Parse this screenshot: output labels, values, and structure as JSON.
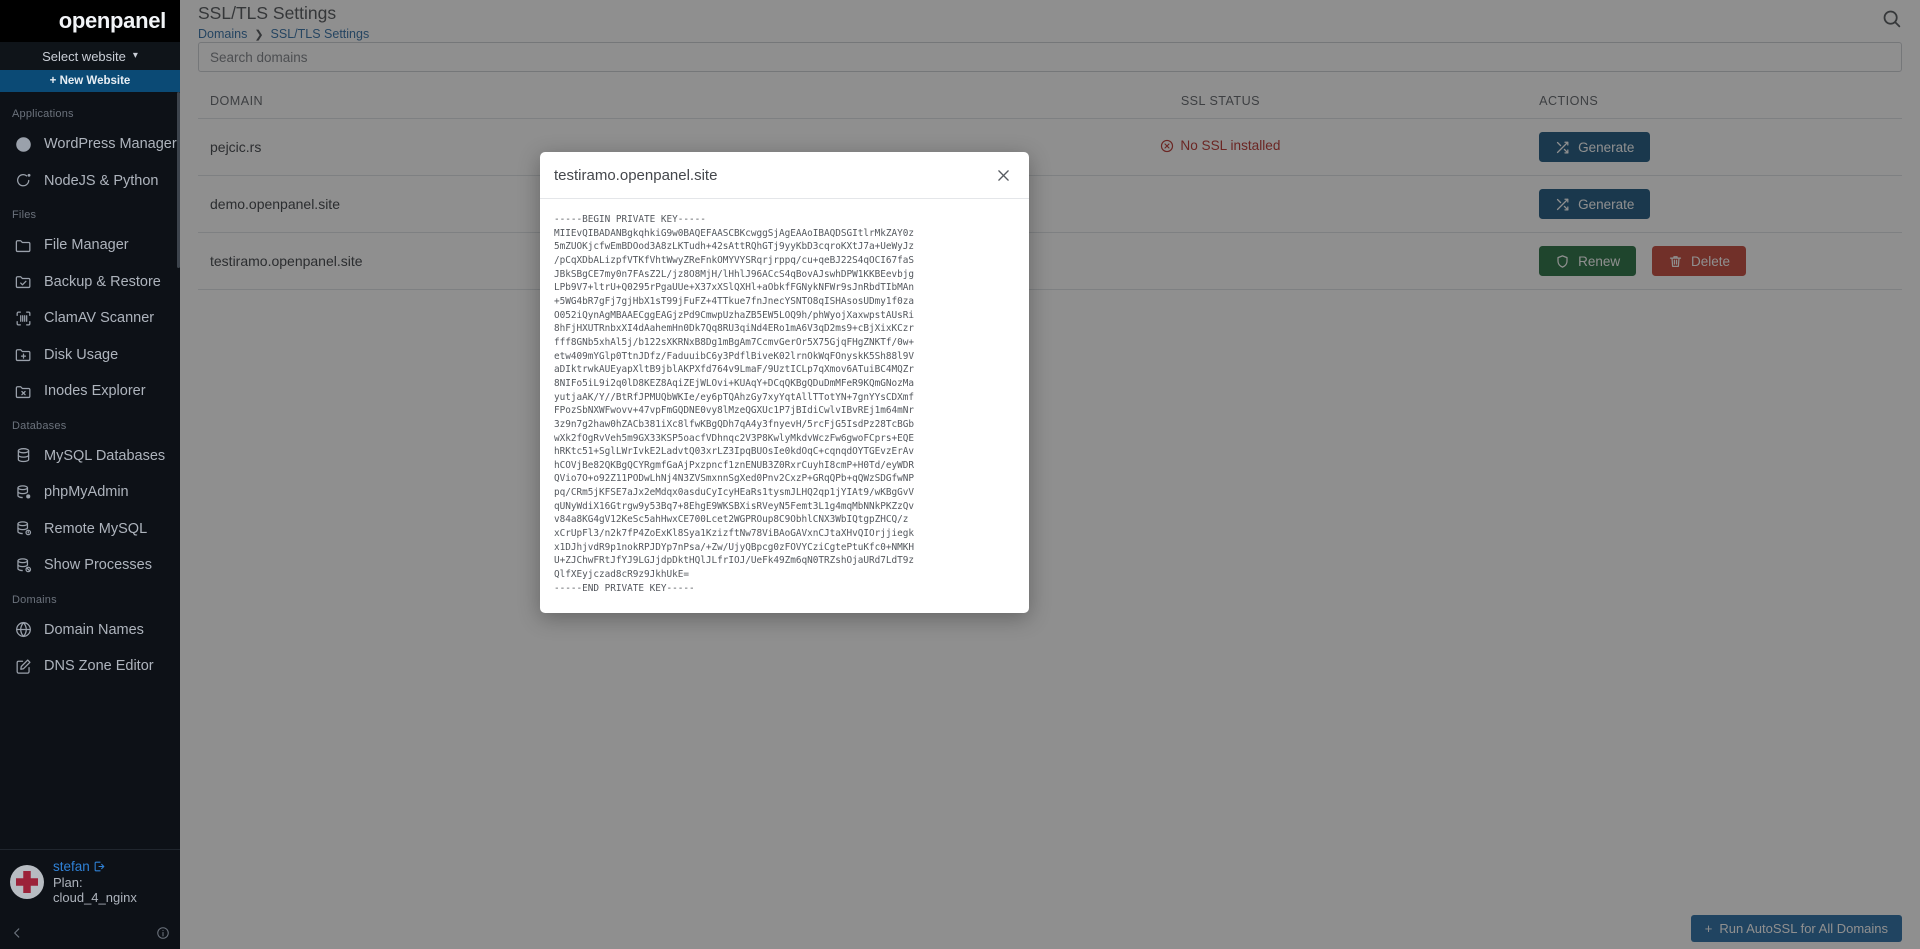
{
  "sidebar": {
    "brand": "openpanel",
    "select_website": "Select website",
    "new_website": "+ New Website",
    "new_website_label": "New Website",
    "groups": [
      {
        "title": "Applications",
        "items": [
          {
            "label": "WordPress Manager",
            "icon": "wordpress-icon"
          },
          {
            "label": "NodeJS & Python",
            "icon": "nodejs-icon"
          }
        ]
      },
      {
        "title": "Files",
        "items": [
          {
            "label": "File Manager",
            "icon": "folder-icon"
          },
          {
            "label": "Backup & Restore",
            "icon": "folder-check-icon"
          },
          {
            "label": "ClamAV Scanner",
            "icon": "scan-icon"
          },
          {
            "label": "Disk Usage",
            "icon": "folder-plus-icon"
          },
          {
            "label": "Inodes Explorer",
            "icon": "folder-x-icon"
          }
        ]
      },
      {
        "title": "Databases",
        "items": [
          {
            "label": "MySQL Databases",
            "icon": "database-icon"
          },
          {
            "label": "phpMyAdmin",
            "icon": "database-gear-icon"
          },
          {
            "label": "Remote MySQL",
            "icon": "database-info-icon"
          },
          {
            "label": "Show Processes",
            "icon": "database-block-icon"
          }
        ]
      },
      {
        "title": "Domains",
        "items": [
          {
            "label": "Domain Names",
            "icon": "globe-icon"
          },
          {
            "label": "DNS Zone Editor",
            "icon": "edit-square-icon"
          }
        ]
      }
    ],
    "user": {
      "name": "stefan",
      "plan": "Plan: cloud_4_nginx"
    }
  },
  "header": {
    "title": "SSL/TLS Settings",
    "breadcrumb": [
      {
        "label": "Domains"
      },
      {
        "label": "SSL/TLS Settings"
      }
    ],
    "breadcrumb_separator": "❯",
    "search_icon": "search-icon"
  },
  "search": {
    "placeholder": "Search domains",
    "value": ""
  },
  "table": {
    "columns": [
      "DOMAIN",
      "SSL STATUS",
      "ACTIONS"
    ],
    "rows": [
      {
        "domain": "pejcic.rs",
        "status": "No SSL installed",
        "status_type": "none",
        "actions": [
          {
            "label": "Generate",
            "type": "generate",
            "icon": "shuffle-icon"
          }
        ]
      },
      {
        "domain": "demo.openpanel.site",
        "status": "",
        "status_type": "hidden",
        "actions": [
          {
            "label": "Generate",
            "type": "generate",
            "icon": "shuffle-icon"
          }
        ]
      },
      {
        "domain": "testiramo.openpanel.site",
        "status": "",
        "status_type": "hidden",
        "actions": [
          {
            "label": "Renew",
            "type": "renew",
            "icon": "shield-icon"
          },
          {
            "label": "Delete",
            "type": "delete",
            "icon": "trash-icon"
          }
        ]
      }
    ]
  },
  "footer": {
    "autossl_label": "Run AutoSSL for All Domains",
    "autossl_icon": "plus-icon"
  },
  "modal": {
    "title": "testiramo.openpanel.site",
    "close_icon": "close-icon",
    "private_key": "-----BEGIN PRIVATE KEY-----\nMIIEvQIBADANBgkqhkiG9w0BAQEFAASCBKcwggSjAgEAAoIBAQDSGItlrMkZAY0z\n5mZUOKjcfwEmBDOod3A8zLKTudh+42sAttRQhGTj9yyKbD3cqroKXtJ7a+UeWyJz\n/pCqXDbALizpfVTKfVhtWwyZReFnkOMYVYSRqrjrppq/cu+qeBJ22S4qOCI67faS\nJBkSBgCE7my0n7FAsZ2L/jz8O8MjH/lHhlJ96ACcS4qBovAJswhDPW1KKBEevbjg\nLPb9V7+ltrU+Q0295rPgaUUe+X37xXSlQXHl+aObkfFGNykNFWr9sJnRbdTIbMAn\n+5WG4bR7gFj7gjHbX1sT99jFuFZ+4TTkue7fnJnecYSNTO8qISHAsosUDmy1f0za\nO052iQynAgMBAAECggEAGjzPd9CmwpUzhaZB5EW5LOQ9h/phWyojXaxwpstAUsRi\n8hFjHXUTRnbxXI4dAahemHn0Dk7Qq8RU3qiNd4ERo1mA6V3qD2ms9+cBjXixKCzr\nfff8GNb5xhAl5j/b122sXKRNxB8Dg1mBgAm7CcmvGerOr5X75GjqFHgZNKTf/0w+\netw409mYGlp0TtnJDfz/FaduuibC6y3PdflBiveK02lrnOkWqFOnyskK5Sh88l9V\naDIktrwkAUEyapXltB9jblAKPXfd764v9LmaF/9UztICLp7qXmov6ATuiBC4MQZr\n8NIFo5iL9i2q0lD8KEZ8AqiZEjWLOvi+KUAqY+DCqQKBgQDuDmMFeR9KQmGNozMa\nyutjaAK/Y//BtRfJPMUQbWKIe/ey6pTQAhzGy7xyYqtAllTTotYN+7gnYYsCDXmf\nFPozSbNXWFwovv+47vpFmGQDNE0vy8lMzeQGXUc1P7jBIdiCwlvIBvREj1m64mNr\n3z9n7g2haw0hZACb381iXc8lfwKBgQDh7qA4y3fnyevH/5rcFjG5IsdPz28TcBGb\nwXk2fOgRvVeh5m9GX33KSP5oacfVDhnqc2V3P8KwlyMkdvWczFw6gwoFCprs+EQE\nhRKtc51+SglLWrIvkE2LadvtQ03xrLZ3IpqBUOsIe0kdOqC+cqnqdOYTGEvzErAv\nhCOVjBe82QKBgQCYRgmfGaAjPxzpncf1znENUB3Z0RxrCuyhI8cmP+H0Td/eyWDR\nQVio7O+o92Z11PODwLhNj4N3ZVSmxnnSgXed0Pnv2CxzP+GRqQPb+qQWzSDGfwNP\npq/CRm5jKFSE7aJx2eMdqx0asduCyIcyHEaRs1tysmJLHQ2qp1jYIAt9/wKBgGvV\nqUNyWdiX16Gtrgw9y53Bq7+8EhgE9WKSBXisRVeyN5Femt3L1g4mqMbNNkPKZzQv\nv84a8KG4gV12KeSc5ahHwxCE700Lcet2WGPROup8C9ObhlCNX3WbIQtgpZHCQ/z\nxCrUpFl3/n2k7fP4ZoExKl8Sya1KzizftNw78ViBAoGAVxnCJtaXHvQIOrjjiegk\nx1DJhjvdR9p1nokRPJDYp7nPsa/+Zw/UjyQBpcg0zFOVYCziCgtePtuKfc0+NMKH\nU+ZJChwFRtJfYJ9LGJjdpDktHQlJLfrIOJ/UeFk49Zm6qN0TRZshOjaURd7LdT9z\nQlfXEyjczad8cR9z9JkhUkE=\n-----END PRIVATE KEY-----"
  }
}
